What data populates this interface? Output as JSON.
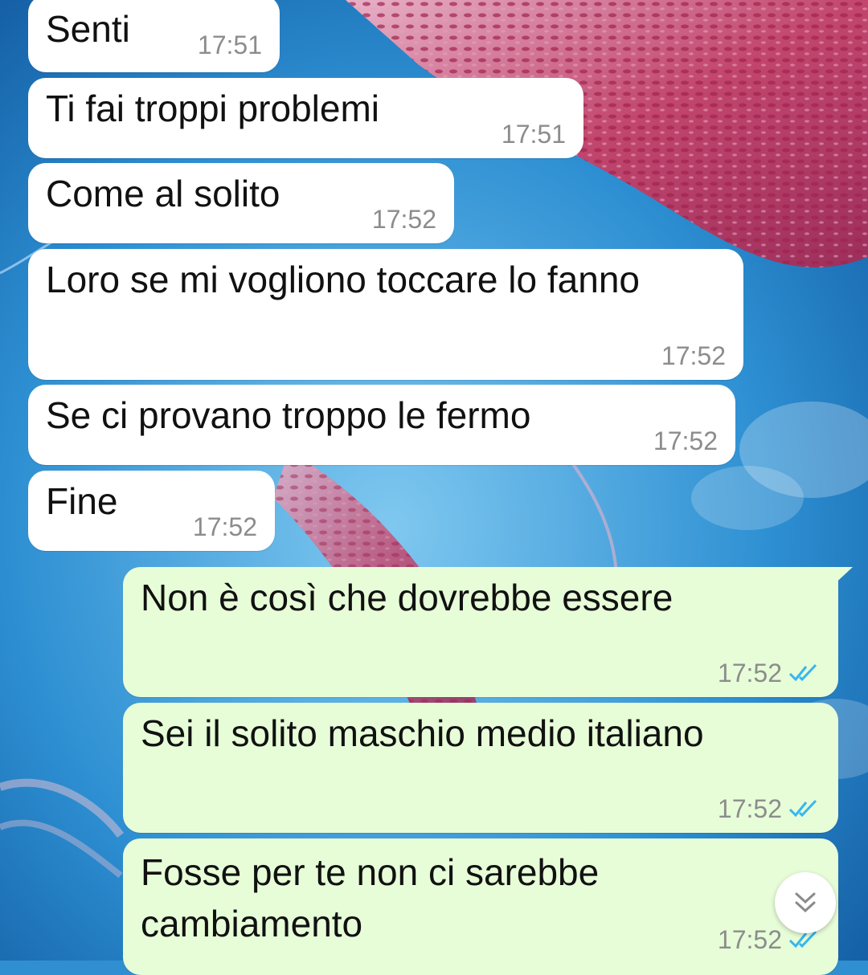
{
  "messages": [
    {
      "text": "Senti",
      "time": "17:51",
      "direction": "incoming"
    },
    {
      "text": "Ti fai troppi problemi",
      "time": "17:51",
      "direction": "incoming"
    },
    {
      "text": "Come al solito",
      "time": "17:52",
      "direction": "incoming"
    },
    {
      "text": "Loro se mi vogliono toccare lo fanno",
      "time": "17:52",
      "direction": "incoming"
    },
    {
      "text": "Se ci provano troppo le fermo",
      "time": "17:52",
      "direction": "incoming"
    },
    {
      "text": "Fine",
      "time": "17:52",
      "direction": "incoming"
    },
    {
      "text": "Non è così che dovrebbe essere",
      "time": "17:52",
      "direction": "outgoing",
      "status": "read"
    },
    {
      "text": "Sei il solito maschio medio italiano",
      "time": "17:52",
      "direction": "outgoing",
      "status": "read"
    },
    {
      "text": "Fosse per te non ci sarebbe\ncambiamento",
      "time": "17:52",
      "direction": "outgoing",
      "status": "read"
    }
  ],
  "icons": {
    "read_receipt": "double-check-icon",
    "scroll_down": "chevron-double-down-icon"
  },
  "colors": {
    "incoming_bubble": "#ffffff",
    "outgoing_bubble": "#e7fdd8",
    "timestamp": "#8c8c8c",
    "read_tick": "#34b7f1"
  }
}
